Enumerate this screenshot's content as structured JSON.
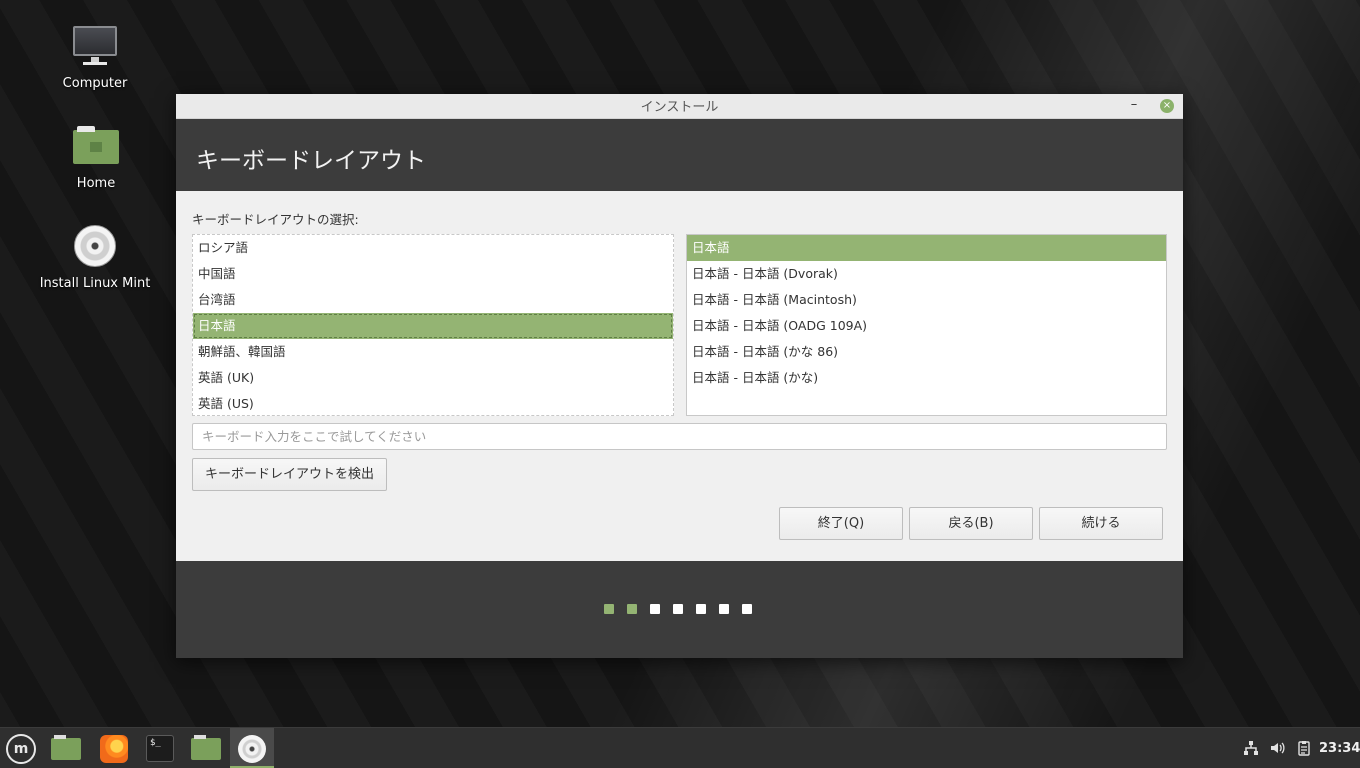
{
  "desktop": {
    "icons": [
      {
        "label": "Computer"
      },
      {
        "label": "Home"
      },
      {
        "label": "Install Linux Mint"
      }
    ]
  },
  "window": {
    "title": "インストール",
    "minimize_glyph": "–",
    "close_glyph": "×"
  },
  "page": {
    "heading": "キーボードレイアウト",
    "select_label": "キーボードレイアウトの選択:",
    "languages": [
      "ロシア語",
      "中国語",
      "台湾語",
      "日本語",
      "朝鮮語、韓国語",
      "英語 (UK)",
      "英語 (US)"
    ],
    "selected_language": "日本語",
    "variants": [
      "日本語",
      "日本語 - 日本語 (Dvorak)",
      "日本語 - 日本語 (Macintosh)",
      "日本語 - 日本語 (OADG 109A)",
      "日本語 - 日本語 (かな 86)",
      "日本語 - 日本語 (かな)"
    ],
    "selected_variant": "日本語",
    "test_placeholder": "キーボード入力をここで試してください",
    "test_value": "",
    "detect_button": "キーボードレイアウトを検出",
    "quit_button": "終了(Q)",
    "back_button": "戻る(B)",
    "continue_button": "続ける"
  },
  "progress": {
    "total_steps": 7,
    "completed_steps": 2
  },
  "taskbar": {
    "menu_glyph": "m",
    "terminal_glyph": "$_",
    "clock": "23:34",
    "tray_icons": [
      "network-icon",
      "volume-icon",
      "clipboard-icon"
    ]
  },
  "colors": {
    "accent": "#94b473",
    "header_bg": "#3c3c3c"
  }
}
